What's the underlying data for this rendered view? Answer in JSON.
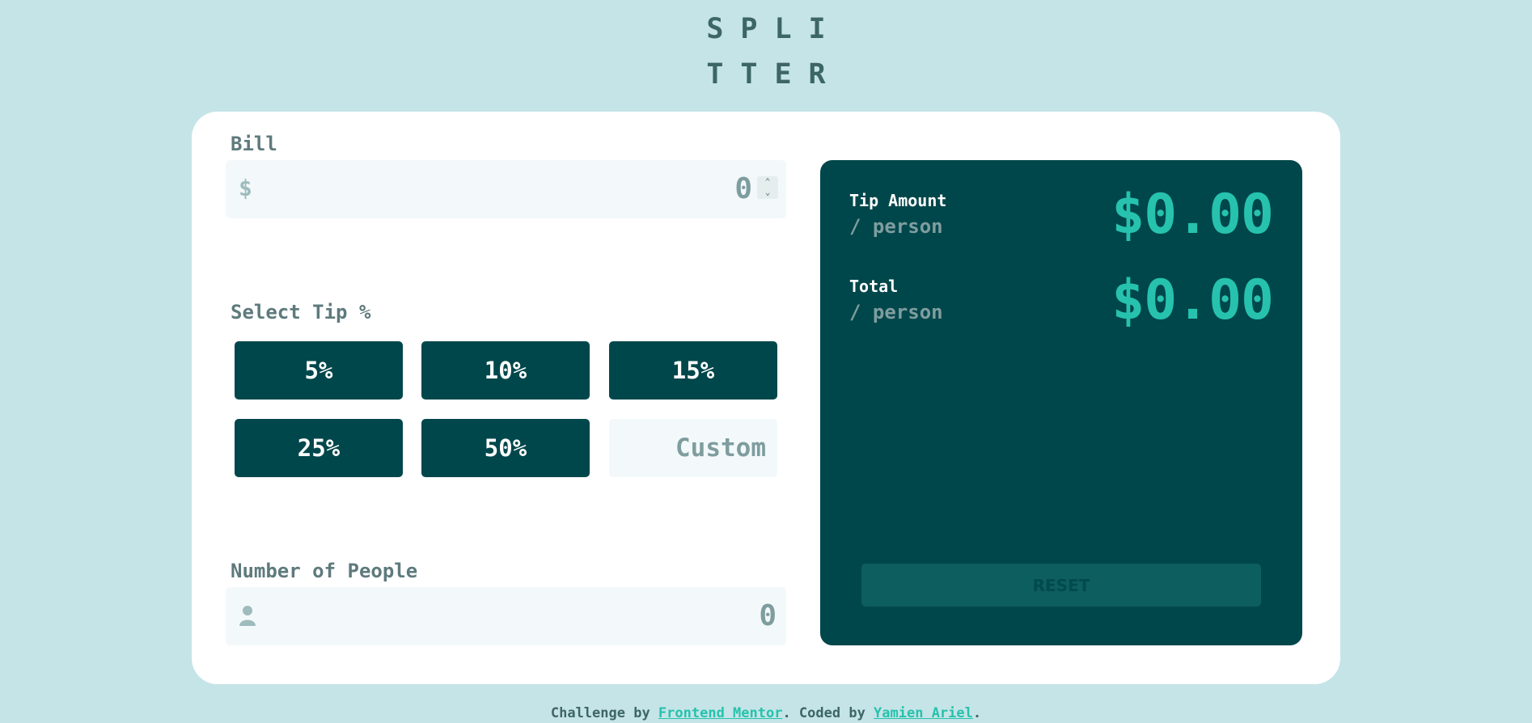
{
  "logo": {
    "line1": "SPLI",
    "line2": "TTER"
  },
  "bill": {
    "label": "Bill",
    "currency_symbol": "$",
    "value": "0"
  },
  "tip": {
    "label": "Select Tip %",
    "options": [
      "5%",
      "10%",
      "15%",
      "25%",
      "50%"
    ],
    "custom_placeholder": "Custom"
  },
  "people": {
    "label": "Number of People",
    "value": "0",
    "icon": "person-icon"
  },
  "results": {
    "tip_amount": {
      "title": "Tip Amount",
      "sub": "/ person",
      "value": "$0.00"
    },
    "total": {
      "title": "Total",
      "sub": "/ person",
      "value": "$0.00"
    },
    "reset_label": "RESET"
  },
  "footer": {
    "prefix": "Challenge by ",
    "link1": "Frontend Mentor",
    "middle": ". Coded by ",
    "link2": "Yamien Ariel",
    "suffix": "."
  },
  "colors": {
    "background": "#c5e4e7",
    "dark_teal": "#00474b",
    "accent": "#26c2ad",
    "input_bg": "#f3f9fa"
  }
}
